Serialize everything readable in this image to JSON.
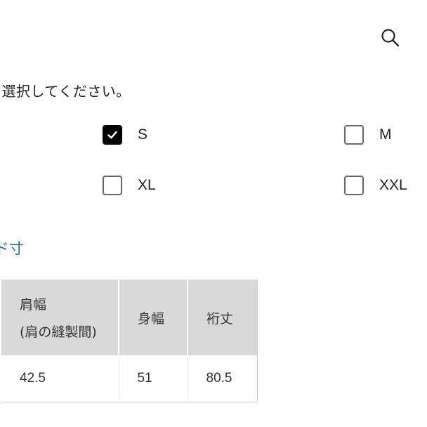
{
  "header": {
    "search_icon": "search-icon"
  },
  "size_select": {
    "instruction": "を選択してください。",
    "options": [
      {
        "label": "S",
        "checked": true
      },
      {
        "label": "M",
        "checked": false
      },
      {
        "label": "XL",
        "checked": false
      },
      {
        "label": "XXL",
        "checked": false
      }
    ]
  },
  "size_chart": {
    "link_label": "ド寸",
    "headers": {
      "shoulder": "肩幅",
      "shoulder_note": "(肩の縫製間)",
      "body_width": "身幅",
      "sleeve_length": "裄丈"
    },
    "row": {
      "shoulder": "42.5",
      "body_width": "51",
      "sleeve_length": "80.5"
    }
  }
}
